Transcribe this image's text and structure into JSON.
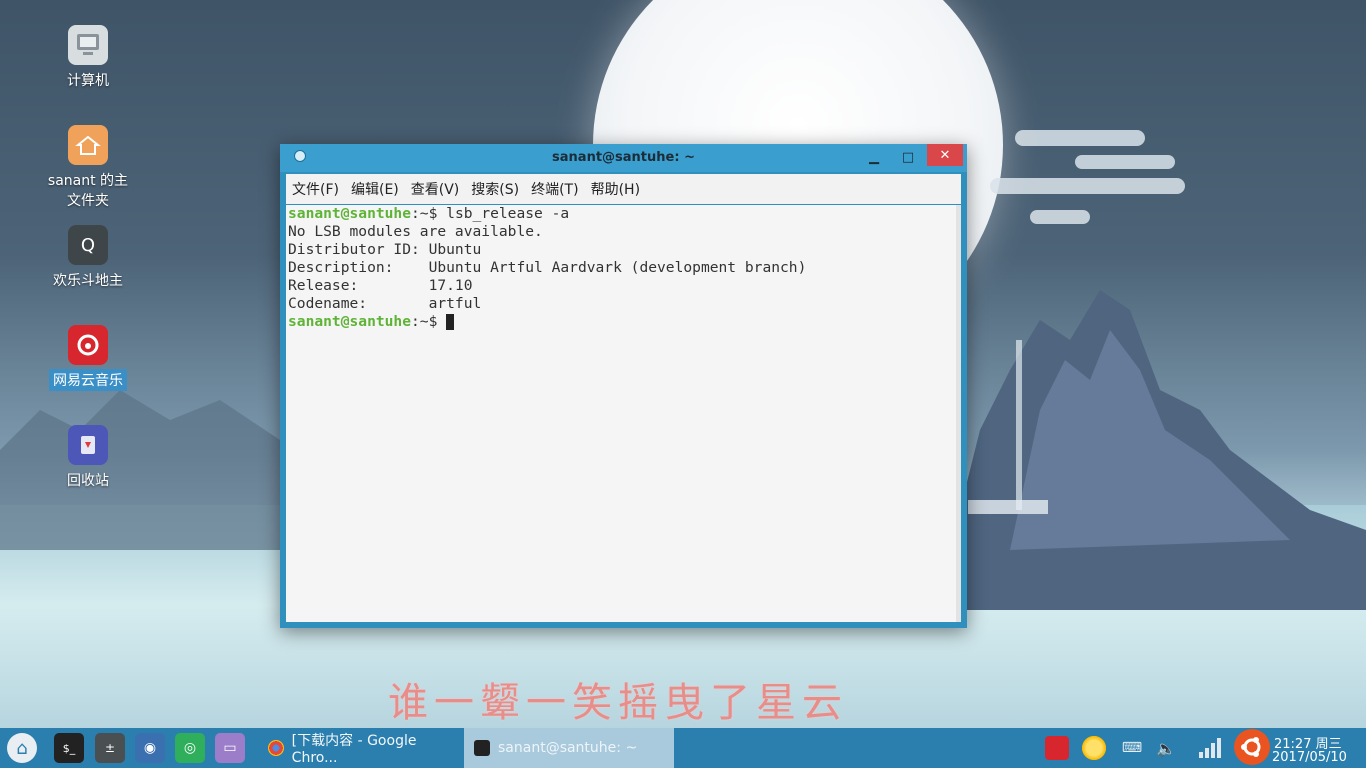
{
  "desktop": {
    "slogan": "谁一颦一笑摇曳了星云",
    "icons": [
      {
        "label": "计算机"
      },
      {
        "label": "sanant 的主文件夹"
      },
      {
        "label": "欢乐斗地主"
      },
      {
        "label": "网易云音乐"
      },
      {
        "label": "回收站"
      }
    ]
  },
  "terminal": {
    "title": "sanant@santuhe: ~",
    "menu": [
      "文件(F)",
      "编辑(E)",
      "查看(V)",
      "搜索(S)",
      "终端(T)",
      "帮助(H)"
    ],
    "prompt": "sanant@santuhe",
    "prompt_suffix": ":~$ ",
    "command": "lsb_release -a",
    "output": [
      "No LSB modules are available.",
      "Distributor ID:\tUbuntu",
      "Description:\tUbuntu Artful Aardvark (development branch)",
      "Release:\t17.10",
      "Codename:\tartful"
    ]
  },
  "taskbar": {
    "tasks": [
      {
        "label": "[下载内容 - Google Chro..."
      },
      {
        "label": "sanant@santuhe: ~"
      }
    ],
    "clock_time": "21:27 周三",
    "clock_date": "2017/05/10"
  },
  "colors": {
    "prompt": "#5fb336",
    "taskbar": "#2a7fae",
    "titlebar": "#3a9fce"
  }
}
